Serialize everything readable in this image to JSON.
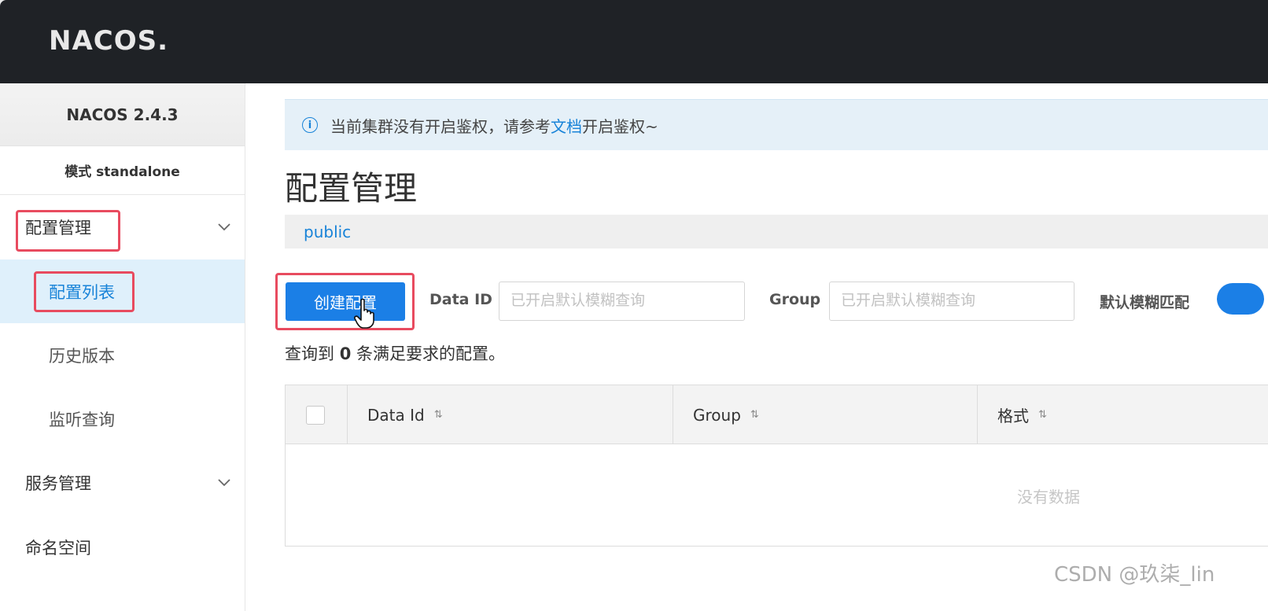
{
  "header": {
    "logo_text": "NACOS."
  },
  "sidebar": {
    "version": "NACOS 2.4.3",
    "mode": "模式 standalone",
    "groups": [
      {
        "label": "配置管理",
        "items": [
          "配置列表",
          "历史版本",
          "监听查询"
        ]
      },
      {
        "label": "服务管理"
      },
      {
        "label": "命名空间"
      }
    ]
  },
  "notice": {
    "prefix": "当前集群没有开启鉴权，请参考",
    "link": "文档",
    "suffix": "开启鉴权~"
  },
  "main": {
    "title": "配置管理",
    "namespace": "public",
    "create_button": "创建配置",
    "data_id_label": "Data ID",
    "data_id_placeholder": "已开启默认模糊查询",
    "group_label": "Group",
    "group_placeholder": "已开启默认模糊查询",
    "fuzzy_label": "默认模糊匹配",
    "summary_prefix": "查询到",
    "summary_count": "0",
    "summary_suffix": "条满足要求的配置。",
    "table_headers": [
      "Data Id",
      "Group",
      "格式"
    ],
    "empty_text": "没有数据"
  },
  "watermark": "CSDN @玖柒_lin",
  "colors": {
    "accent": "#1b7fe6",
    "highlight": "#e84b5f",
    "header_bg": "#1f2226"
  }
}
